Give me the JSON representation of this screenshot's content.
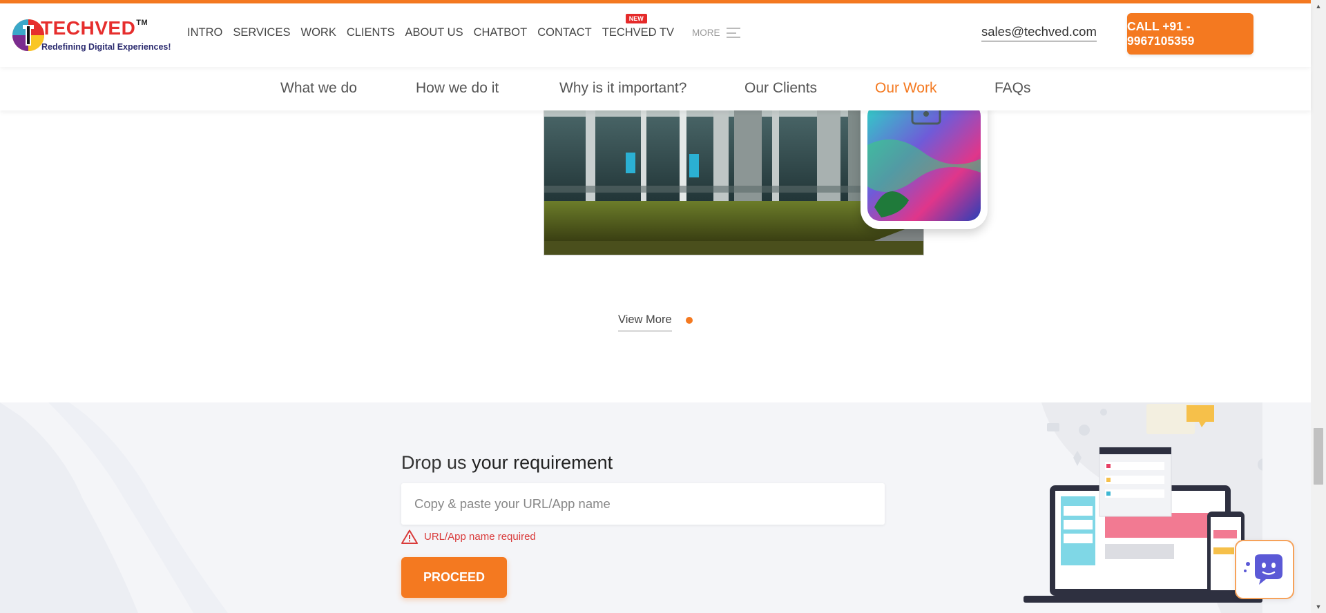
{
  "brand": {
    "name": "TECHVED",
    "trademark": "TM",
    "tagline": "Redefining Digital Experiences!"
  },
  "nav": {
    "items": [
      {
        "label": "INTRO"
      },
      {
        "label": "SERVICES"
      },
      {
        "label": "WORK"
      },
      {
        "label": "CLIENTS"
      },
      {
        "label": "ABOUT US"
      },
      {
        "label": "CHATBOT"
      },
      {
        "label": "CONTACT"
      },
      {
        "label": "TECHVED TV",
        "badge": "NEW"
      }
    ],
    "more_label": "MORE"
  },
  "header": {
    "email": "sales@techved.com",
    "call_label": "CALL +91 - 9967105359"
  },
  "subnav": {
    "items": [
      {
        "label": "What we do"
      },
      {
        "label": "How we do it"
      },
      {
        "label": "Why is it important?"
      },
      {
        "label": "Our Clients"
      },
      {
        "label": "Our Work",
        "active": true
      },
      {
        "label": "FAQs"
      }
    ]
  },
  "work": {
    "view_more_label": "View More"
  },
  "requirement": {
    "title_light": "Drop us",
    "title_bold": "your requirement",
    "input_placeholder": "Copy & paste your URL/App name",
    "input_value": "",
    "error_text": "URL/App name required",
    "proceed_label": "PROCEED"
  },
  "colors": {
    "accent": "#f47920",
    "error": "#d93a3a",
    "section_bg": "#f4f5f8"
  }
}
